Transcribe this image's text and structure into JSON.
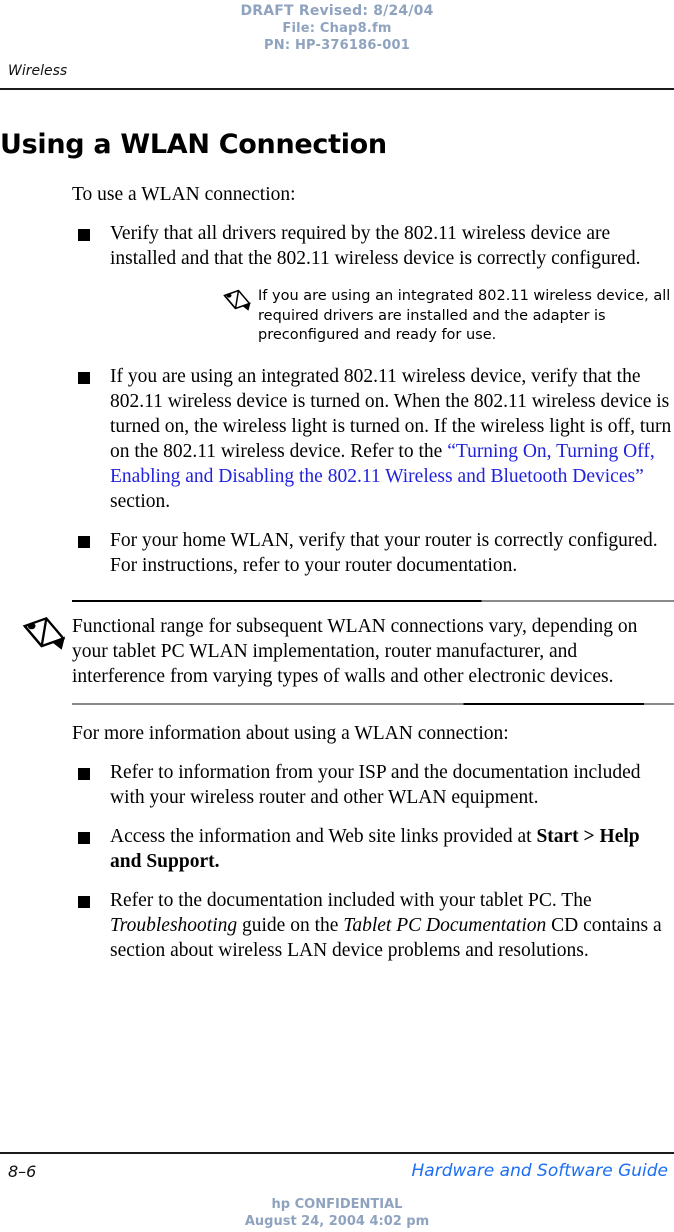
{
  "draft_stamp": {
    "line1": "DRAFT Revised: 8/24/04",
    "line2": "File: Chap8.fm",
    "line3": "PN: HP-376186-001",
    "color": "#8fa3bf"
  },
  "running_header": {
    "chapter": "Wireless"
  },
  "section": {
    "title": "Using a WLAN Connection",
    "intro": "To use a WLAN connection:"
  },
  "bullets_1": [
    {
      "text": "Verify that all drivers required by the 802.11 wireless device are installed and that the 802.11 wireless device is correctly configured."
    },
    {
      "prefix": "If you are using an integrated 802.11 wireless device, verify that the 802.11 wireless device is turned on. When the 802.11 wireless device is turned on, the wireless light is turned on. If the wireless light is off, turn on the 802.11 wireless device. Refer to the ",
      "xref": "“Turning On, Turning Off, Enabling and Disabling the 802.11 Wireless and Bluetooth Devices”",
      "suffix": " section."
    },
    {
      "text": "For your home WLAN, verify that your router is correctly configured. For instructions, refer to your router documentation."
    }
  ],
  "note_inline": {
    "icon": "pencil-icon",
    "text": "If you are using an integrated 802.11 wireless device, all required drivers are installed and the adapter is preconfigured and ready for use."
  },
  "note_ruled": {
    "icon": "pencil-icon",
    "text": "Functional range for subsequent WLAN connections vary, depending on your tablet PC WLAN implementation, router manufacturer, and interference from varying types of walls and other electronic devices."
  },
  "more_info": {
    "intro": "For more information about using a WLAN connection:"
  },
  "bullets_2": [
    {
      "text": "Refer to information from your ISP and the documentation included with your wireless router and other WLAN equipment."
    },
    {
      "prefix": "Access the information and Web site links provided at ",
      "bold": "Start > Help and Support."
    },
    {
      "part1": "Refer to the documentation included with your tablet PC. The ",
      "ital1": "Troubleshooting",
      "part2": " guide on the ",
      "ital2": "Tablet PC Documentation",
      "part3": " CD contains a section about wireless LAN device problems and resolutions."
    }
  ],
  "footer": {
    "page_number": "8–6",
    "guide_title": "Hardware and Software Guide",
    "guide_color": "#1b6ef3",
    "confidential": "hp CONFIDENTIAL",
    "timestamp": "August 24, 2004 4:02 pm"
  }
}
